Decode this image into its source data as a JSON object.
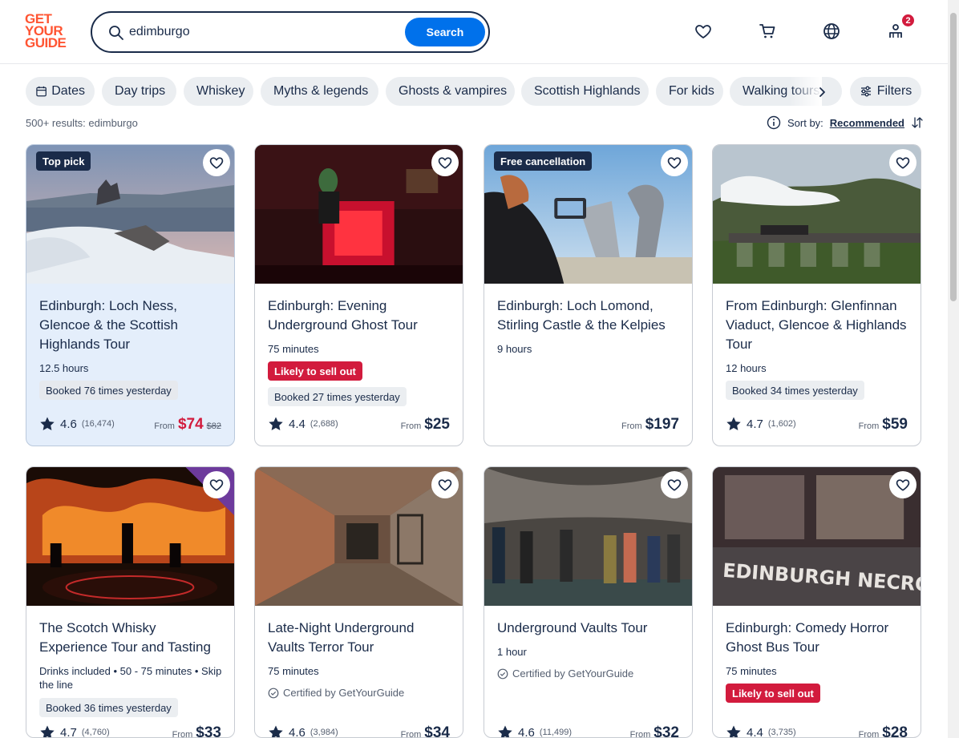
{
  "header": {
    "logo_lines": [
      "GET",
      "YOUR",
      "GUIDE"
    ],
    "search_value": "edimburgo",
    "search_button": "Search",
    "account_badge": "2"
  },
  "chips": [
    "Dates",
    "Day trips",
    "Whiskey",
    "Myths & legends",
    "Ghosts & vampires",
    "Scottish Highlands",
    "For kids",
    "Walking tours"
  ],
  "filters_label": "Filters",
  "results_text": "500+ results: edimburgo",
  "sort": {
    "label": "Sort by:",
    "value": "Recommended"
  },
  "cards": [
    {
      "tag": "Top pick",
      "title": "Edinburgh: Loch Ness, Glencoe & the Scottish Highlands Tour",
      "meta": "12.5 hours",
      "booked": "Booked 76 times yesterday",
      "rating": "4.6",
      "reviews": "(16,474)",
      "from": "From",
      "price": "$74",
      "old_price": "$82"
    },
    {
      "title": "Edinburgh: Evening Underground Ghost Tour",
      "meta": "75 minutes",
      "sell_out": "Likely to sell out",
      "booked": "Booked 27 times yesterday",
      "rating": "4.4",
      "reviews": "(2,688)",
      "from": "From",
      "price": "$25"
    },
    {
      "tag": "Free cancellation",
      "title": "Edinburgh: Loch Lomond, Stirling Castle & the Kelpies",
      "meta": "9 hours",
      "from": "From",
      "price": "$197"
    },
    {
      "title": "From Edinburgh: Glenfinnan Viaduct, Glencoe & Highlands Tour",
      "meta": "12 hours",
      "booked": "Booked 34 times yesterday",
      "rating": "4.7",
      "reviews": "(1,602)",
      "from": "From",
      "price": "$59"
    },
    {
      "title": "The Scotch Whisky Experience Tour and Tasting",
      "meta": "Drinks included • 50 - 75 minutes • Skip the line",
      "booked": "Booked 36 times yesterday",
      "rating": "4.7",
      "reviews": "(4,760)",
      "from": "From",
      "price": "$33"
    },
    {
      "title": "Late-Night Underground Vaults Terror Tour",
      "meta": "75 minutes",
      "certified": "Certified by GetYourGuide",
      "rating": "4.6",
      "reviews": "(3,984)",
      "from": "From",
      "price": "$34"
    },
    {
      "title": "Underground Vaults Tour",
      "meta": "1 hour",
      "certified": "Certified by GetYourGuide",
      "rating": "4.6",
      "reviews": "(11,499)",
      "from": "From",
      "price": "$32"
    },
    {
      "title": "Edinburgh: Comedy Horror Ghost Bus Tour",
      "meta": "75 minutes",
      "sell_out": "Likely to sell out",
      "rating": "4.4",
      "reviews": "(3,735)",
      "from": "From",
      "price": "$28",
      "image_text": "EDINBURGH NECROBUS"
    }
  ]
}
